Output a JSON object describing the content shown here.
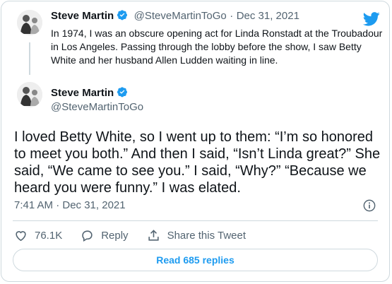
{
  "reply_tweet": {
    "display_name": "Steve Martin",
    "handle": "@SteveMartinToGo",
    "separator": "·",
    "date": "Dec 31, 2021",
    "text": "In 1974, I was an obscure opening act for Linda Ronstadt at the Troubadour in Los Angeles.  Passing through the lobby before the show, I saw Betty White and her husband Allen Ludden waiting in line."
  },
  "main_tweet": {
    "display_name": "Steve Martin",
    "handle": "@SteveMartinToGo",
    "text": "I loved Betty White, so I went up to them: “I’m so honored to meet you both.” And then I said, “Isn’t Linda great?” She said, “We came to see you.” I said, “Why?” “Because we heard you were funny.” I was elated.",
    "timestamp": "7:41 AM · Dec 31, 2021"
  },
  "actions": {
    "like_count": "76.1K",
    "reply_label": "Reply",
    "share_label": "Share this Tweet"
  },
  "read_replies_label": "Read 685 replies",
  "colors": {
    "accent": "#1d9bf0",
    "text": "#0f1419",
    "muted": "#536471",
    "border": "#cfd9de"
  },
  "icons": [
    "twitter-bird-icon",
    "verified-badge-icon",
    "info-icon",
    "heart-icon",
    "reply-icon",
    "share-icon"
  ]
}
